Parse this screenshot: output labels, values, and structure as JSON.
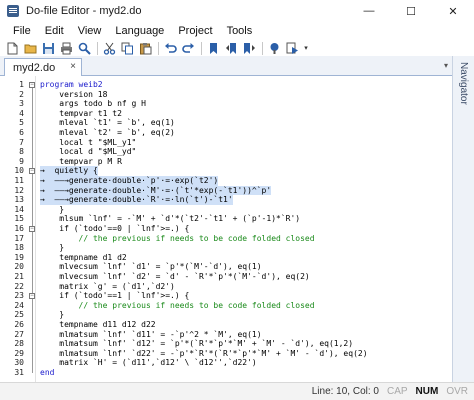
{
  "window": {
    "title": "Do-file Editor - myd2.do"
  },
  "window_controls": {
    "minimize": "—",
    "maximize": "☐",
    "close": "✕"
  },
  "menu": [
    "File",
    "Edit",
    "View",
    "Language",
    "Project",
    "Tools"
  ],
  "toolbar": [
    "new-icon",
    "open-icon",
    "save-icon",
    "print-icon",
    "find-icon",
    "cut-icon",
    "copy-icon",
    "paste-icon",
    "undo-icon",
    "redo-icon",
    "bookmark-icon",
    "prev-bookmark-icon",
    "next-bookmark-icon",
    "show-file-icon",
    "execute-icon"
  ],
  "tab": {
    "label": "myd2.do",
    "close": "×",
    "arrow": "▾"
  },
  "side_panel": {
    "label": "Navigator"
  },
  "editor": {
    "lines": [
      {
        "n": "1",
        "text": "program weib2",
        "cls": "kw"
      },
      {
        "n": "2",
        "text": "    version 18",
        "cls": ""
      },
      {
        "n": "3",
        "text": "    args todo b nf g H",
        "cls": ""
      },
      {
        "n": "4",
        "text": "    tempvar t1 t2",
        "cls": ""
      },
      {
        "n": "5",
        "text": "    mleval `t1' = `b', eq(1)",
        "cls": ""
      },
      {
        "n": "6",
        "text": "    mleval `t2' = `b', eq(2)",
        "cls": ""
      },
      {
        "n": "7",
        "text": "    local t \"$ML_y1\"",
        "cls": ""
      },
      {
        "n": "8",
        "text": "    local d \"$ML_yd\"",
        "cls": ""
      },
      {
        "n": "9",
        "text": "    tempvar p M R",
        "cls": ""
      },
      {
        "n": "10",
        "text": "→  quietly {",
        "cls": ""
      },
      {
        "n": "11",
        "text": "→  ——→generate·double·`p'·=·exp(`t2')",
        "cls": ""
      },
      {
        "n": "12",
        "text": "→  ——→generate·double·`M'·=·(`t'*exp(-`t1'))^`p'",
        "cls": ""
      },
      {
        "n": "13",
        "text": "→  ——→generate·double·`R'·=·ln(`t')-`t1'",
        "cls": ""
      },
      {
        "n": "14",
        "text": "    }",
        "cls": ""
      },
      {
        "n": "15",
        "text": "    mlsum `lnf' = -`M' + `d'*(`t2'-`t1' + (`p'-1)*`R')",
        "cls": ""
      },
      {
        "n": "16",
        "text": "    if (`todo'==0 | `lnf'>=.) {",
        "cls": ""
      },
      {
        "n": "17",
        "text": "        // the previous if needs to be code folded closed",
        "cls": "cmt"
      },
      {
        "n": "18",
        "text": "    }",
        "cls": ""
      },
      {
        "n": "19",
        "text": "    tempname d1 d2",
        "cls": ""
      },
      {
        "n": "20",
        "text": "    mlvecsum `lnf' `d1' = `p'*(`M'-`d'), eq(1)",
        "cls": ""
      },
      {
        "n": "21",
        "text": "    mlvecsum `lnf' `d2' = `d' - `R'*`p'*(`M'-`d'), eq(2)",
        "cls": ""
      },
      {
        "n": "22",
        "text": "    matrix `g' = (`d1',`d2')",
        "cls": ""
      },
      {
        "n": "23",
        "text": "    if (`todo'==1 | `lnf'>=.) {",
        "cls": ""
      },
      {
        "n": "24",
        "text": "        // the previous if needs to be code folded closed",
        "cls": "cmt"
      },
      {
        "n": "25",
        "text": "    }",
        "cls": ""
      },
      {
        "n": "26",
        "text": "    tempname d11 d12 d22",
        "cls": ""
      },
      {
        "n": "27",
        "text": "    mlmatsum `lnf' `d11' = -`p'^2 * `M', eq(1)",
        "cls": ""
      },
      {
        "n": "28",
        "text": "    mlmatsum `lnf' `d12' = `p'*(`R'*`p'*`M' + `M' - `d'), eq(1,2)",
        "cls": ""
      },
      {
        "n": "29",
        "text": "    mlmatsum `lnf' `d22' = -`p'*`R'*(`R'*`p'*`M' + `M' - `d'), eq(2)",
        "cls": ""
      },
      {
        "n": "30",
        "text": "    matrix `H' = (`d11',`d12' \\ `d12'',`d22')",
        "cls": ""
      },
      {
        "n": "31",
        "text": "end",
        "cls": "kw"
      }
    ],
    "selected_lines": [
      "10",
      "11",
      "12",
      "13"
    ]
  },
  "status": {
    "position": "Line: 10, Col: 0",
    "caps": "CAP",
    "num": "NUM",
    "ovr": "OVR"
  }
}
